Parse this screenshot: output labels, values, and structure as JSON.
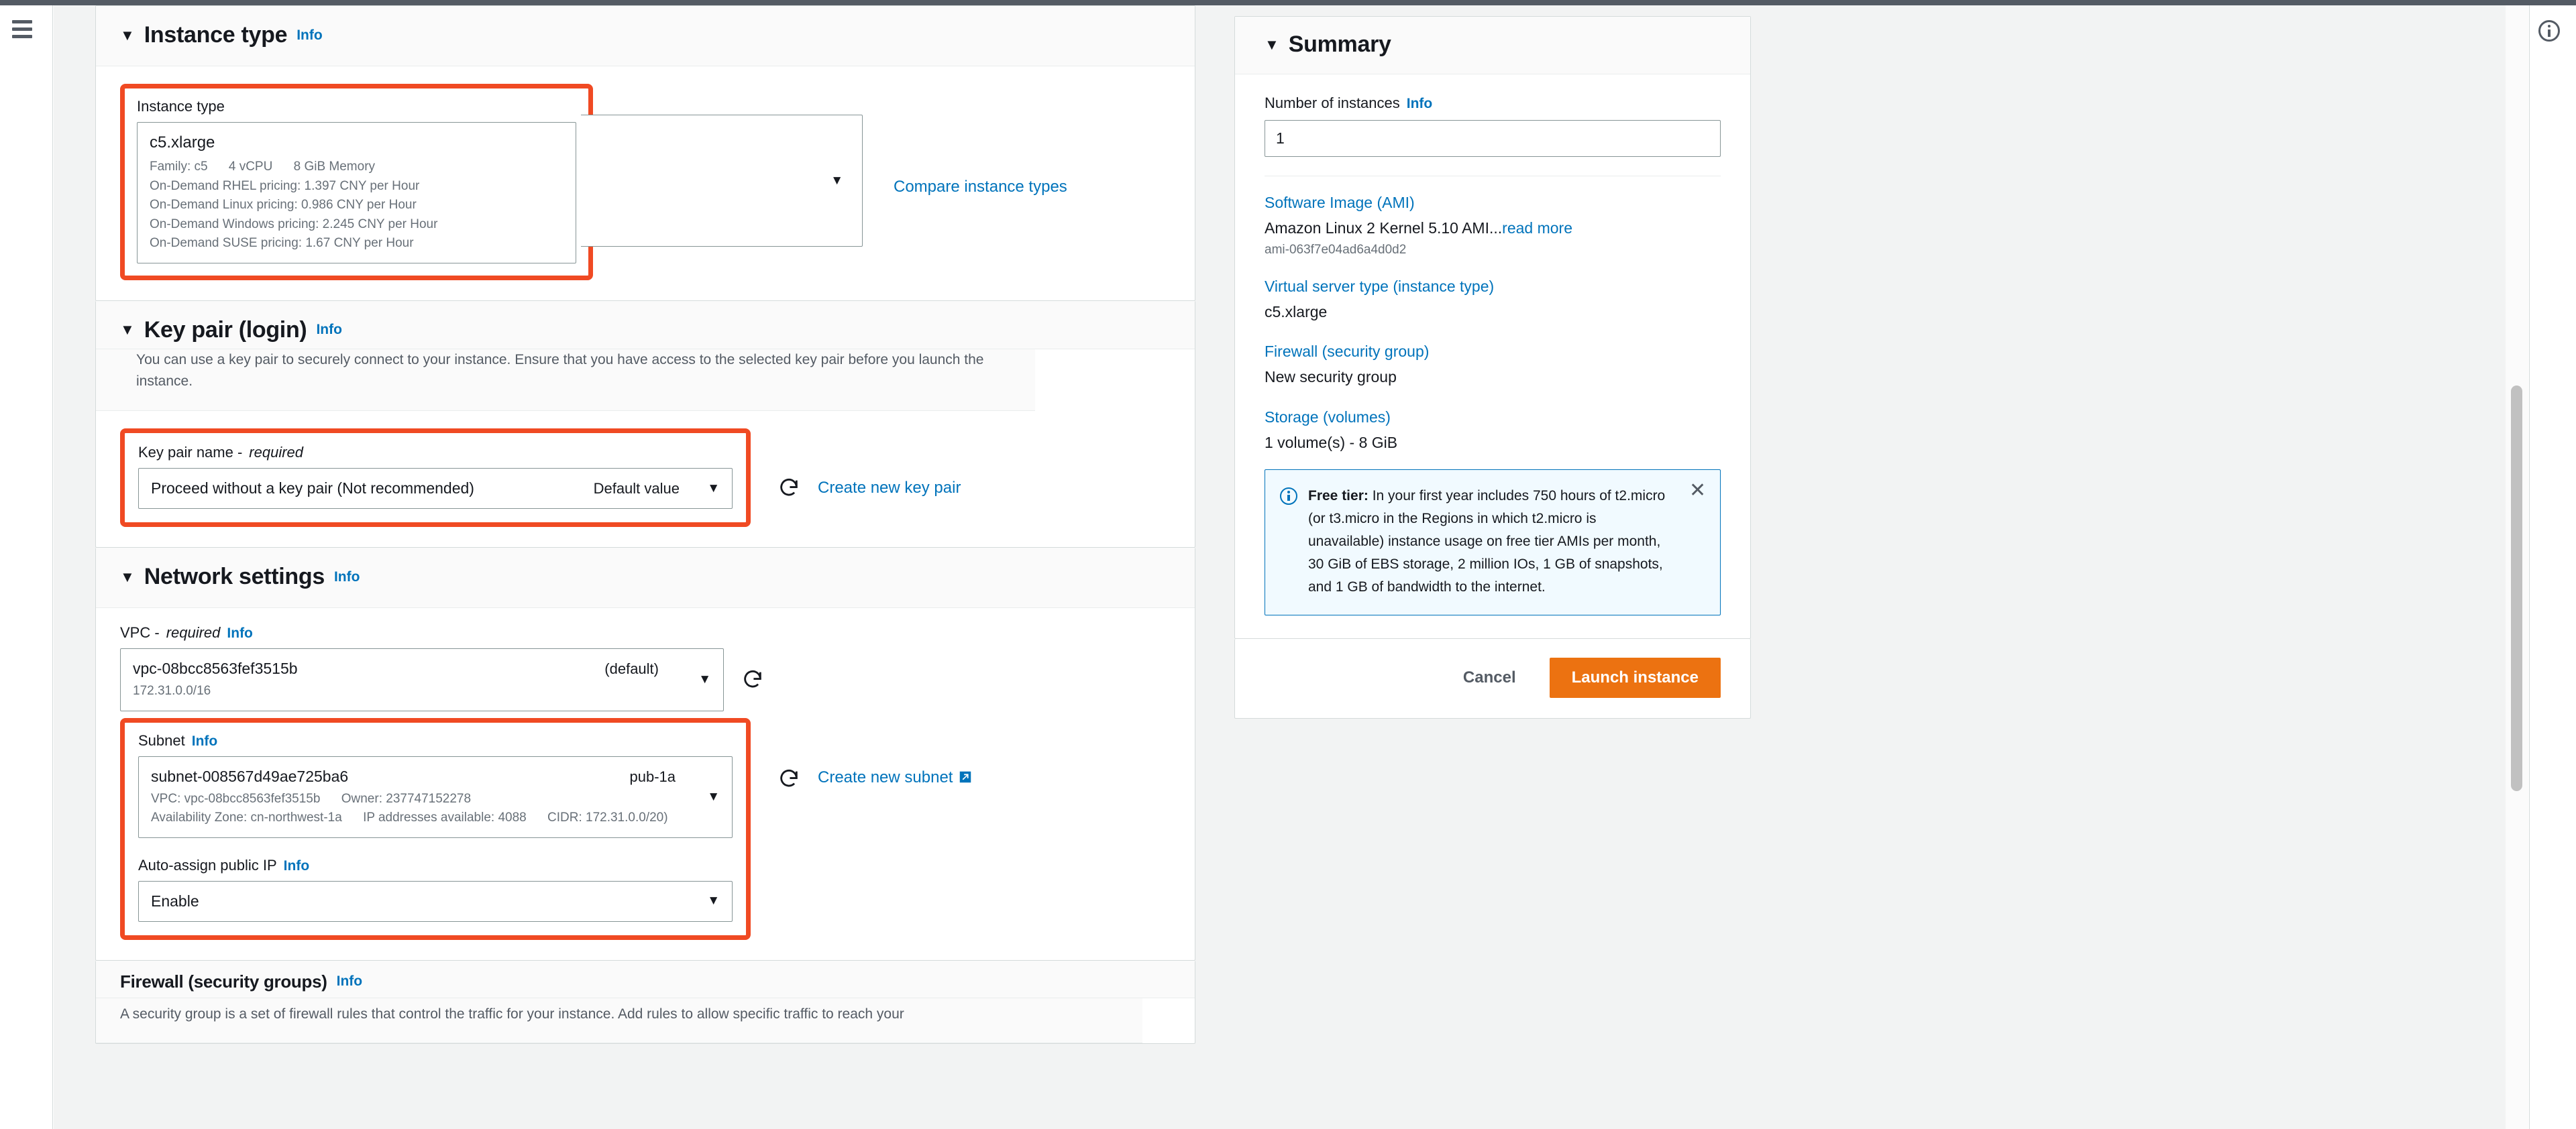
{
  "chrome": {
    "menu_icon": "hamburger-icon",
    "info_icon": "info-circle-icon"
  },
  "instance_type_section": {
    "title": "Instance type",
    "info_label": "Info",
    "caret": "▼",
    "field_label": "Instance type",
    "selected": {
      "name": "c5.xlarge",
      "family": "Family: c5",
      "vcpu": "4 vCPU",
      "memory": "8 GiB Memory",
      "pricing_rhel": "On-Demand RHEL pricing: 1.397 CNY per Hour",
      "pricing_linux": "On-Demand Linux pricing: 0.986 CNY per Hour",
      "pricing_windows": "On-Demand Windows pricing: 2.245 CNY per Hour",
      "pricing_suse": "On-Demand SUSE pricing: 1.67 CNY per Hour"
    },
    "compare_link": "Compare instance types",
    "chevron": "▼"
  },
  "key_pair_section": {
    "title": "Key pair (login)",
    "info_label": "Info",
    "caret": "▼",
    "description": "You can use a key pair to securely connect to your instance. Ensure that you have access to the selected key pair before you launch the instance.",
    "field_label": "Key pair name -",
    "field_label_required": "required",
    "selected_value": "Proceed without a key pair (Not recommended)",
    "default_hint": "Default value",
    "chevron": "▼",
    "refresh_icon": "refresh-icon",
    "create_link": "Create new key pair"
  },
  "network_section": {
    "title": "Network settings",
    "info_label": "Info",
    "caret": "▼",
    "vpc": {
      "label": "VPC -",
      "label_required": "required",
      "info_label": "Info",
      "value": "vpc-08bcc8563fef3515b",
      "badge": "(default)",
      "cidr": "172.31.0.0/16",
      "chevron": "▼",
      "refresh_icon": "refresh-icon"
    },
    "subnet": {
      "label": "Subnet",
      "info_label": "Info",
      "value": "subnet-008567d49ae725ba6",
      "badge": "pub-1a",
      "meta_vpc": "VPC: vpc-08bcc8563fef3515b",
      "meta_owner": "Owner: 237747152278",
      "meta_az": "Availability Zone: cn-northwest-1a",
      "meta_ips": "IP addresses available: 4088",
      "meta_cidr": "CIDR: 172.31.0.0/20)",
      "chevron": "▼",
      "refresh_icon": "refresh-icon",
      "create_link": "Create new subnet",
      "external_icon": "external-link-icon"
    },
    "auto_assign_ip": {
      "label": "Auto-assign public IP",
      "info_label": "Info",
      "value": "Enable",
      "chevron": "▼"
    }
  },
  "firewall_section": {
    "title": "Firewall (security groups)",
    "info_label": "Info",
    "description": "A security group is a set of firewall rules that control the traffic for your instance. Add rules to allow specific traffic to reach your"
  },
  "summary": {
    "title": "Summary",
    "caret": "▼",
    "number_of_instances_label": "Number of instances",
    "info_label": "Info",
    "number_of_instances_value": "1",
    "ami_link": "Software Image (AMI)",
    "ami_value": "Amazon Linux 2 Kernel 5.10 AMI...",
    "ami_read_more": "read more",
    "ami_id": "ami-063f7e04ad6a4d0d2",
    "instance_type_link": "Virtual server type (instance type)",
    "instance_type_value": "c5.xlarge",
    "firewall_link": "Firewall (security group)",
    "firewall_value": "New security group",
    "storage_link": "Storage (volumes)",
    "storage_value": "1 volume(s) - 8 GiB",
    "free_tier": {
      "bold_prefix": "Free tier:",
      "body": " In your first year includes 750 hours of t2.micro (or t3.micro in the Regions in which t2.micro is unavailable) instance usage on free tier AMIs per month, 30 GiB of EBS storage, 2 million IOs, 1 GB of snapshots, and 1 GB of bandwidth to the internet.",
      "close_icon": "close-icon",
      "info_icon": "info-icon"
    },
    "cancel_label": "Cancel",
    "launch_label": "Launch instance"
  },
  "colors": {
    "highlight": "#f04a23",
    "link": "#0073bb",
    "launch_button": "#ec7211",
    "page_background": "#f2f3f3"
  }
}
